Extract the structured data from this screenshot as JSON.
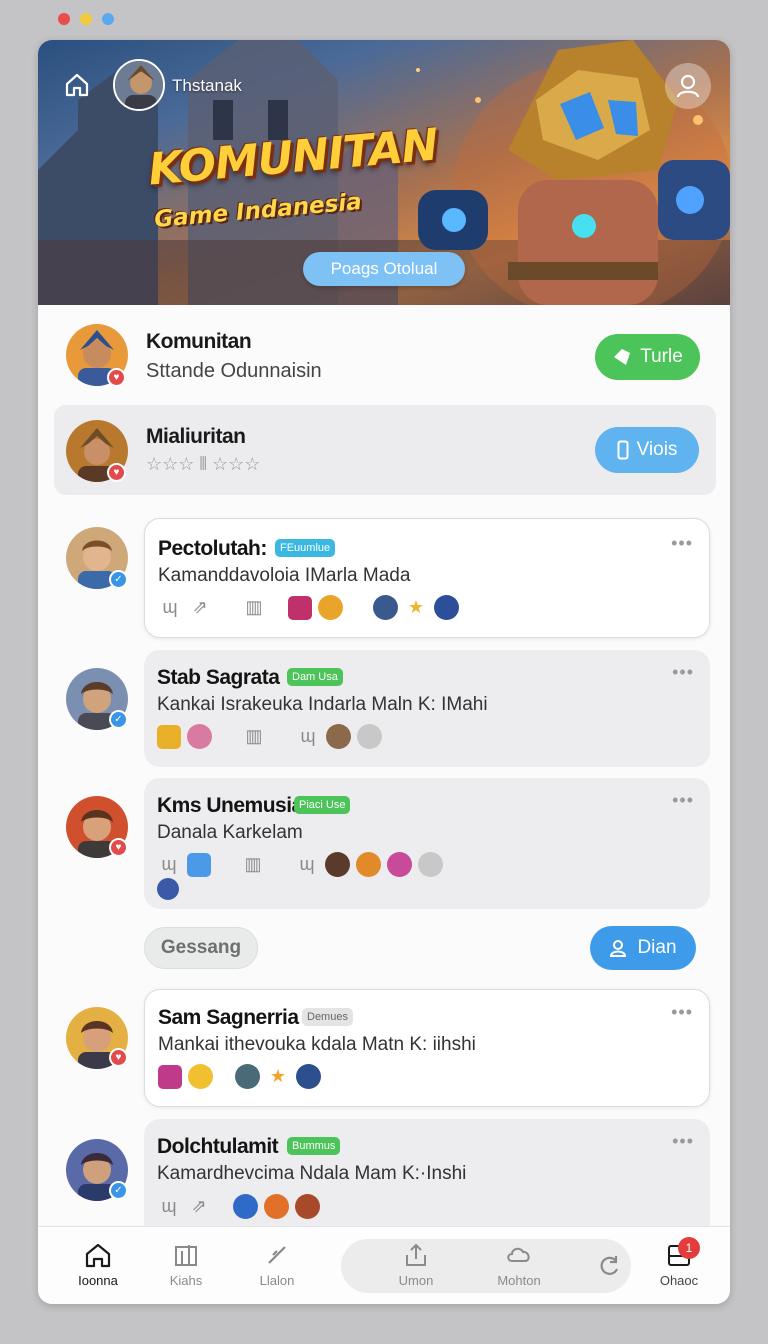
{
  "hero": {
    "username": "Thstanak",
    "title": "KOMUNITAN",
    "subtitle": "Game Indanesia",
    "button_label": "Poags Otolual"
  },
  "communities": [
    {
      "title": "Komunitan",
      "subtitle": "Sttande Odunnaisin",
      "button": "Turle",
      "button_color": "#4cc459",
      "badge_color": "#e24b4b"
    },
    {
      "title": "Mialiuritan",
      "subtitle": "☆☆☆  ⫴  ☆☆☆",
      "button": "Viois",
      "button_color": "#5fb4ef",
      "badge_color": "#e24b4b"
    }
  ],
  "posts": [
    {
      "name": "Pectolutah:",
      "tag": "FEuumlue",
      "tag_color": "#3ab8e0",
      "text": "Kamanddavoloia IMarla Mada",
      "more": "•••",
      "badge_color": "#3a95e6"
    },
    {
      "name": "Stab Sagrata",
      "tag": "Dam Usa",
      "tag_color": "#4cc459",
      "text": "Kankai Israkeuka Indarla Maln K: IMahi",
      "more": "•••",
      "badge_color": "#3a95e6"
    },
    {
      "name": "Kms Unemusia",
      "tag": "Piaci Use",
      "tag_color": "#4cc459",
      "text": "Danala Karkelam",
      "more": "•••",
      "badge_color": "#e24b4b"
    },
    {
      "name": "Sam Sagnerria",
      "tag": "Demues",
      "tag_color": "#e4e4e4",
      "text": "Mankai ithevouka kdala Matn K: iihshi",
      "more": "•••",
      "badge_color": "#e24b4b"
    },
    {
      "name": "Dolchtulamit",
      "tag": "Bummus",
      "tag_color": "#4cc459",
      "text": "Kamardhevcima Ndala Mam K:·Inshi",
      "more": "•••",
      "badge_color": "#3a95e6"
    }
  ],
  "actions": {
    "left": "Gessang",
    "right": "Dian"
  },
  "nav": {
    "items": [
      "Ioonna",
      "Kiahs",
      "Llalon",
      "Umon",
      "Mohton",
      "Ohaoc"
    ],
    "notification_count": "1"
  },
  "colors": {
    "accent_blue": "#5fb4ef",
    "accent_green": "#4cc459",
    "alert_red": "#e23c3c"
  }
}
